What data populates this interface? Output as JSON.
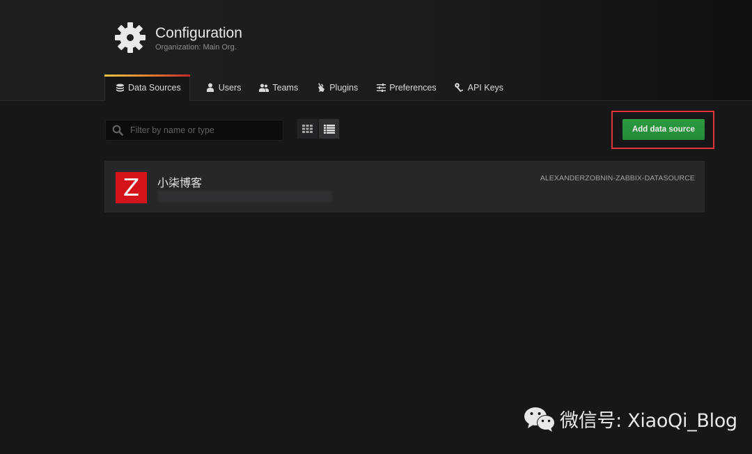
{
  "header": {
    "icon": "gear-icon",
    "title": "Configuration",
    "subtitle": "Organization: Main Org."
  },
  "tabs": [
    {
      "label": "Data Sources",
      "icon": "database-icon",
      "active": true
    },
    {
      "label": "Users",
      "icon": "user-icon",
      "active": false
    },
    {
      "label": "Teams",
      "icon": "users-icon",
      "active": false
    },
    {
      "label": "Plugins",
      "icon": "plug-icon",
      "active": false
    },
    {
      "label": "Preferences",
      "icon": "sliders-icon",
      "active": false
    },
    {
      "label": "API Keys",
      "icon": "key-icon",
      "active": false
    }
  ],
  "toolbar": {
    "filter_placeholder": "Filter by name or type",
    "filter_value": "",
    "view_modes": [
      {
        "name": "grid-view",
        "icon": "grid-icon",
        "active": false
      },
      {
        "name": "list-view",
        "icon": "list-icon",
        "active": true
      }
    ],
    "add_button_label": "Add data source"
  },
  "datasources": [
    {
      "logo_letter": "Z",
      "name": "小柒博客",
      "url": "",
      "type": "ALEXANDERZOBNIN-ZABBIX-DATASOURCE"
    }
  ],
  "colors": {
    "accent_green": "#299c46",
    "highlight_red": "#e0343a",
    "zabbix_red": "#d5131b",
    "tab_accent_start": "#f6c343",
    "tab_accent_end": "#c42727"
  },
  "watermark": {
    "icon": "wechat-icon",
    "text": "微信号: XiaoQi_Blog"
  }
}
